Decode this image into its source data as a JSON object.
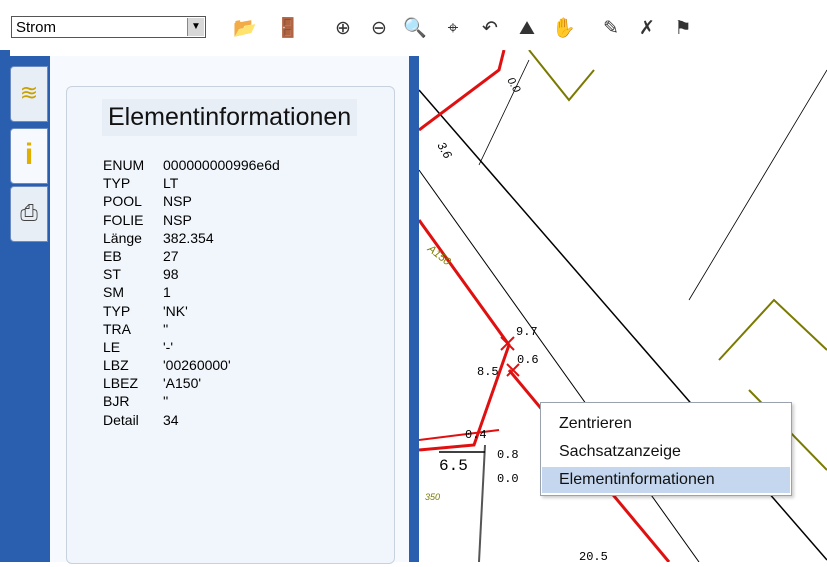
{
  "toolbar": {
    "layer_select_value": "Strom",
    "tools": [
      {
        "icon": "folder-open-icon",
        "glyph": "📂"
      },
      {
        "icon": "exit-door-icon",
        "glyph": "🚪"
      },
      {
        "icon": "zoom-in-icon",
        "glyph": "⊕"
      },
      {
        "icon": "zoom-out-icon",
        "glyph": "⊖"
      },
      {
        "icon": "zoom-icon",
        "glyph": "🔍"
      },
      {
        "icon": "crosshair-icon",
        "glyph": "⌖"
      },
      {
        "icon": "undo-icon",
        "glyph": "↶"
      },
      {
        "icon": "tree-icon",
        "glyph": "⛰"
      },
      {
        "icon": "hand-pan-icon",
        "glyph": "✋"
      },
      {
        "icon": "measure-icon",
        "glyph": "✎"
      },
      {
        "icon": "delete-measure-icon",
        "glyph": "✗"
      },
      {
        "icon": "flag-icon",
        "glyph": "⚑"
      }
    ]
  },
  "sidetabs": [
    {
      "icon": "layers-icon",
      "glyph": "≋",
      "color": "#c8a000"
    },
    {
      "icon": "info-icon",
      "glyph": "i",
      "color": "#e0b000"
    },
    {
      "icon": "printer-icon",
      "glyph": "⎙",
      "color": "#444"
    }
  ],
  "panel": {
    "title": "Elementinformationen",
    "rows": [
      {
        "k": "ENUM",
        "v": "000000000996e6d"
      },
      {
        "k": "TYP",
        "v": "LT"
      },
      {
        "k": "POOL",
        "v": "NSP"
      },
      {
        "k": "FOLIE",
        "v": "NSP"
      },
      {
        "k": "Länge",
        "v": "382.354"
      },
      {
        "k": "EB",
        "v": "27"
      },
      {
        "k": "ST",
        "v": "98"
      },
      {
        "k": "SM",
        "v": "1"
      },
      {
        "k": "TYP",
        "v": "'NK'"
      },
      {
        "k": "TRA",
        "v": "''"
      },
      {
        "k": "LE",
        "v": "'-'"
      },
      {
        "k": "LBZ",
        "v": "'00260000'"
      },
      {
        "k": "LBEZ",
        "v": "'A150'"
      },
      {
        "k": "BJR",
        "v": "''"
      },
      {
        "k": "Detail",
        "v": "34"
      }
    ]
  },
  "map": {
    "labels": [
      "0.0",
      "3.6",
      "A150",
      "9.7",
      "0.6",
      "8.5",
      "0.4",
      "6.5",
      "0.8",
      "0.0",
      "350",
      "20.5"
    ]
  },
  "context_menu": {
    "items": [
      "Zentrieren",
      "Sachsatzanzeige",
      "Elementinformationen"
    ],
    "selected_index": 2
  },
  "colors": {
    "accent": "#2a5fb0",
    "cable": "#e01010",
    "parcel": "#7a7a00",
    "selection": "#c5d7ef"
  }
}
